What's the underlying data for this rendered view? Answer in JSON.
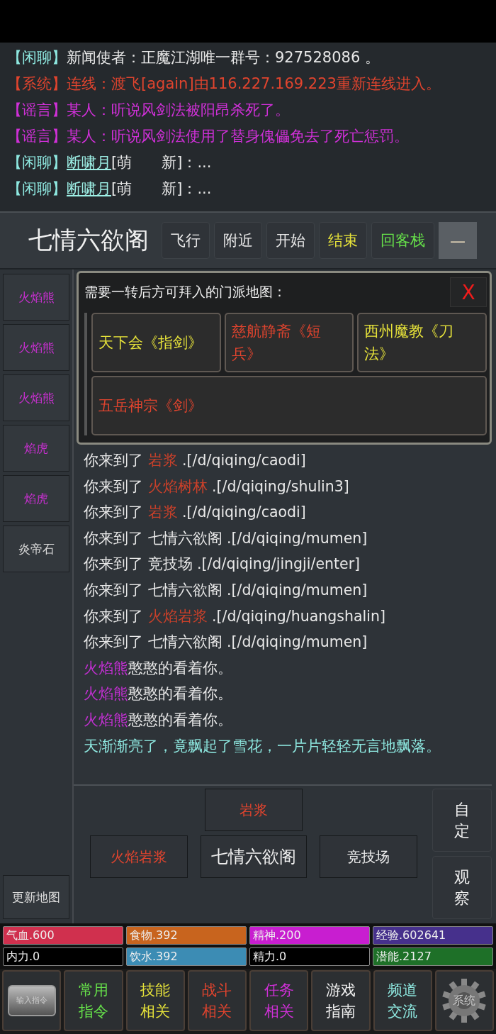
{
  "chat": [
    {
      "channel": "【闲聊】",
      "kind": "chat",
      "text": "新闻使者：正魔江湖唯一群号：927528086 。"
    },
    {
      "channel": "【系统】",
      "kind": "system",
      "text": "连线：渡飞[again]由116.227.169.223重新连线进入。"
    },
    {
      "channel": "【谣言】",
      "kind": "rumor",
      "text": "某人：听说风剑法被阳昂杀死了。"
    },
    {
      "channel": "【谣言】",
      "kind": "rumor",
      "text": "某人：听说风剑法使用了替身傀儡免去了死亡惩罚。"
    },
    {
      "channel": "【闲聊】",
      "kind": "chat",
      "speaker": "断啸月",
      "text": "[萌　　新]：..."
    },
    {
      "channel": "【闲聊】",
      "kind": "chat",
      "speaker": "断啸月",
      "text": "[萌　　新]：..."
    }
  ],
  "location": {
    "title": "七情六欲阁",
    "actions": [
      {
        "label": "飞行",
        "color": "#e8e8e8"
      },
      {
        "label": "附近",
        "color": "#e8e8e8"
      },
      {
        "label": "开始",
        "color": "#e8e8e8"
      },
      {
        "label": "结束",
        "color": "#e6e23a"
      },
      {
        "label": "回客栈",
        "color": "#66e04a"
      }
    ],
    "collapse": "—"
  },
  "sidebar": {
    "items": [
      {
        "label": "火焰熊",
        "kind": "monster"
      },
      {
        "label": "火焰熊",
        "kind": "monster"
      },
      {
        "label": "火焰熊",
        "kind": "monster"
      },
      {
        "label": "焰虎",
        "kind": "monster"
      },
      {
        "label": "焰虎",
        "kind": "monster"
      },
      {
        "label": "炎帝石",
        "kind": "item"
      }
    ],
    "refresh": "更新地图"
  },
  "popup": {
    "title": "需要一转后方可拜入的门派地图：",
    "close": "X",
    "options": [
      {
        "label": "天下会《指剑》",
        "color": "#e6e23a"
      },
      {
        "label": "慈航静斋《短兵》",
        "color": "#e0442e"
      },
      {
        "label": "西州魔教《刀法》",
        "color": "#e6e23a"
      },
      {
        "label": "五岳神宗《剑》",
        "color": "#e0442e"
      }
    ]
  },
  "log": [
    {
      "kind": "arrival",
      "prefix": "你来到了",
      "place": "岩浆",
      "hot": true,
      "path": " .[/d/qiqing/caodi]"
    },
    {
      "kind": "arrival",
      "prefix": "你来到了",
      "place": "火焰树林",
      "hot": true,
      "path": " .[/d/qiqing/shulin3]"
    },
    {
      "kind": "arrival",
      "prefix": "你来到了",
      "place": "岩浆",
      "hot": true,
      "path": " .[/d/qiqing/caodi]"
    },
    {
      "kind": "arrival",
      "prefix": "你来到了",
      "place": "七情六欲阁",
      "hot": false,
      "path": " .[/d/qiqing/mumen]"
    },
    {
      "kind": "arrival",
      "prefix": "你来到了",
      "place": "竞技场",
      "hot": false,
      "path": " .[/d/qiqing/jingji/enter]"
    },
    {
      "kind": "arrival",
      "prefix": "你来到了",
      "place": "七情六欲阁",
      "hot": false,
      "path": " .[/d/qiqing/mumen]"
    },
    {
      "kind": "arrival",
      "prefix": "你来到了",
      "place": "火焰岩浆",
      "hot": true,
      "path": " .[/d/qiqing/huangshalin]"
    },
    {
      "kind": "arrival",
      "prefix": "你来到了",
      "place": "七情六欲阁",
      "hot": false,
      "path": " .[/d/qiqing/mumen]"
    },
    {
      "kind": "npc",
      "name": "火焰熊",
      "text": "憨憨的看着你。"
    },
    {
      "kind": "npc",
      "name": "火焰熊",
      "text": "憨憨的看着你。"
    },
    {
      "kind": "npc",
      "name": "火焰熊",
      "text": "憨憨的看着你。"
    },
    {
      "kind": "weather",
      "text": "天渐渐亮了，竟飘起了雪花，一片片轻轻无言地飘落。"
    }
  ],
  "exits": [
    [
      {
        "label": "岩浆",
        "hot": true
      }
    ],
    [
      {
        "label": "火焰岩浆",
        "hot": true
      },
      {
        "label": "七情六欲阁",
        "kind": "current",
        "hot": false
      },
      {
        "label": "竞技场",
        "hot": false
      }
    ]
  ],
  "side_buttons": [
    "自定",
    "观察"
  ],
  "stats": [
    {
      "label": "气血.600",
      "color": "#d0304e"
    },
    {
      "label": "食物.392",
      "color": "#c8641e"
    },
    {
      "label": "精神.200",
      "color": "#c81ed0"
    },
    {
      "label": "经验.602641",
      "color": "#46308c"
    },
    {
      "label": "内力.0",
      "color": "#000000"
    },
    {
      "label": "饮水.392",
      "color": "#3c8cb4"
    },
    {
      "label": "精力.0",
      "color": "#000000"
    },
    {
      "label": "潜能.2127",
      "color": "#1e7028"
    }
  ],
  "nav": [
    {
      "kind": "image",
      "label": "输入指令"
    },
    {
      "kind": "text",
      "lines": [
        "常用",
        "指令"
      ],
      "color": "#66e04a"
    },
    {
      "kind": "text",
      "lines": [
        "技能",
        "相关"
      ],
      "color": "#e6e23a"
    },
    {
      "kind": "text",
      "lines": [
        "战斗",
        "相关"
      ],
      "color": "#e0442e"
    },
    {
      "kind": "text",
      "lines": [
        "任务",
        "相关"
      ],
      "color": "#d030d8"
    },
    {
      "kind": "text",
      "lines": [
        "游戏",
        "指南"
      ],
      "color": "#f0f0f0"
    },
    {
      "kind": "text",
      "lines": [
        "频道",
        "交流"
      ],
      "color": "#8ee8e0"
    },
    {
      "kind": "gear",
      "label": "系统"
    }
  ]
}
